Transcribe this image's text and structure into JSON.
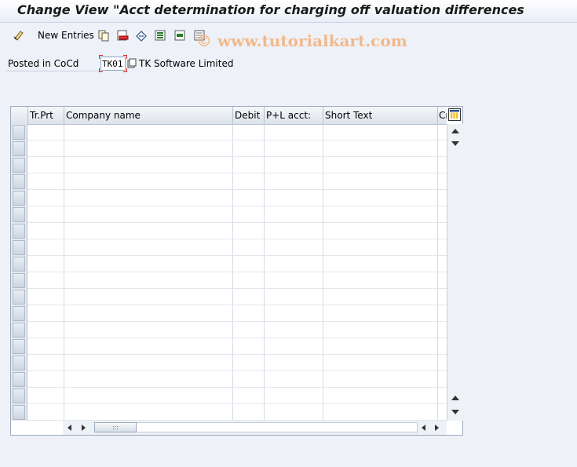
{
  "window": {
    "title": "Change View \"Acct determination for charging off valuation differences"
  },
  "toolbar": {
    "new_entries_label": "New Entries"
  },
  "watermark": "© www.tutorialkart.com",
  "header_field": {
    "label": "Posted in CoCd",
    "value": "TK01",
    "description": "TK Software Limited"
  },
  "table": {
    "columns": [
      "Tr.Prt",
      "Company name",
      "Debit",
      "P+L acct:",
      "Short Text",
      "Cr"
    ],
    "rows": [
      [
        "",
        "",
        "",
        "",
        "",
        ""
      ],
      [
        "",
        "",
        "",
        "",
        "",
        ""
      ],
      [
        "",
        "",
        "",
        "",
        "",
        ""
      ],
      [
        "",
        "",
        "",
        "",
        "",
        ""
      ],
      [
        "",
        "",
        "",
        "",
        "",
        ""
      ],
      [
        "",
        "",
        "",
        "",
        "",
        ""
      ],
      [
        "",
        "",
        "",
        "",
        "",
        ""
      ],
      [
        "",
        "",
        "",
        "",
        "",
        ""
      ],
      [
        "",
        "",
        "",
        "",
        "",
        ""
      ],
      [
        "",
        "",
        "",
        "",
        "",
        ""
      ],
      [
        "",
        "",
        "",
        "",
        "",
        ""
      ],
      [
        "",
        "",
        "",
        "",
        "",
        ""
      ],
      [
        "",
        "",
        "",
        "",
        "",
        ""
      ],
      [
        "",
        "",
        "",
        "",
        "",
        ""
      ],
      [
        "",
        "",
        "",
        "",
        "",
        ""
      ],
      [
        "",
        "",
        "",
        "",
        "",
        ""
      ],
      [
        "",
        "",
        "",
        "",
        "",
        ""
      ],
      [
        "",
        "",
        "",
        "",
        "",
        ""
      ]
    ]
  },
  "icons": {
    "toolbar": [
      "edit-glasses-icon",
      "copy-as-icon",
      "delete-icon",
      "undo-change-icon",
      "select-all-icon",
      "select-block-icon",
      "deselect-all-icon"
    ],
    "table": [
      "table-settings-icon",
      "scroll-up-icon",
      "scroll-down-icon",
      "scroll-left-icon",
      "scroll-right-icon"
    ]
  },
  "colors": {
    "background": "#eef2f8",
    "watermark": "#f2b98b",
    "required_marker": "#dd2222"
  }
}
